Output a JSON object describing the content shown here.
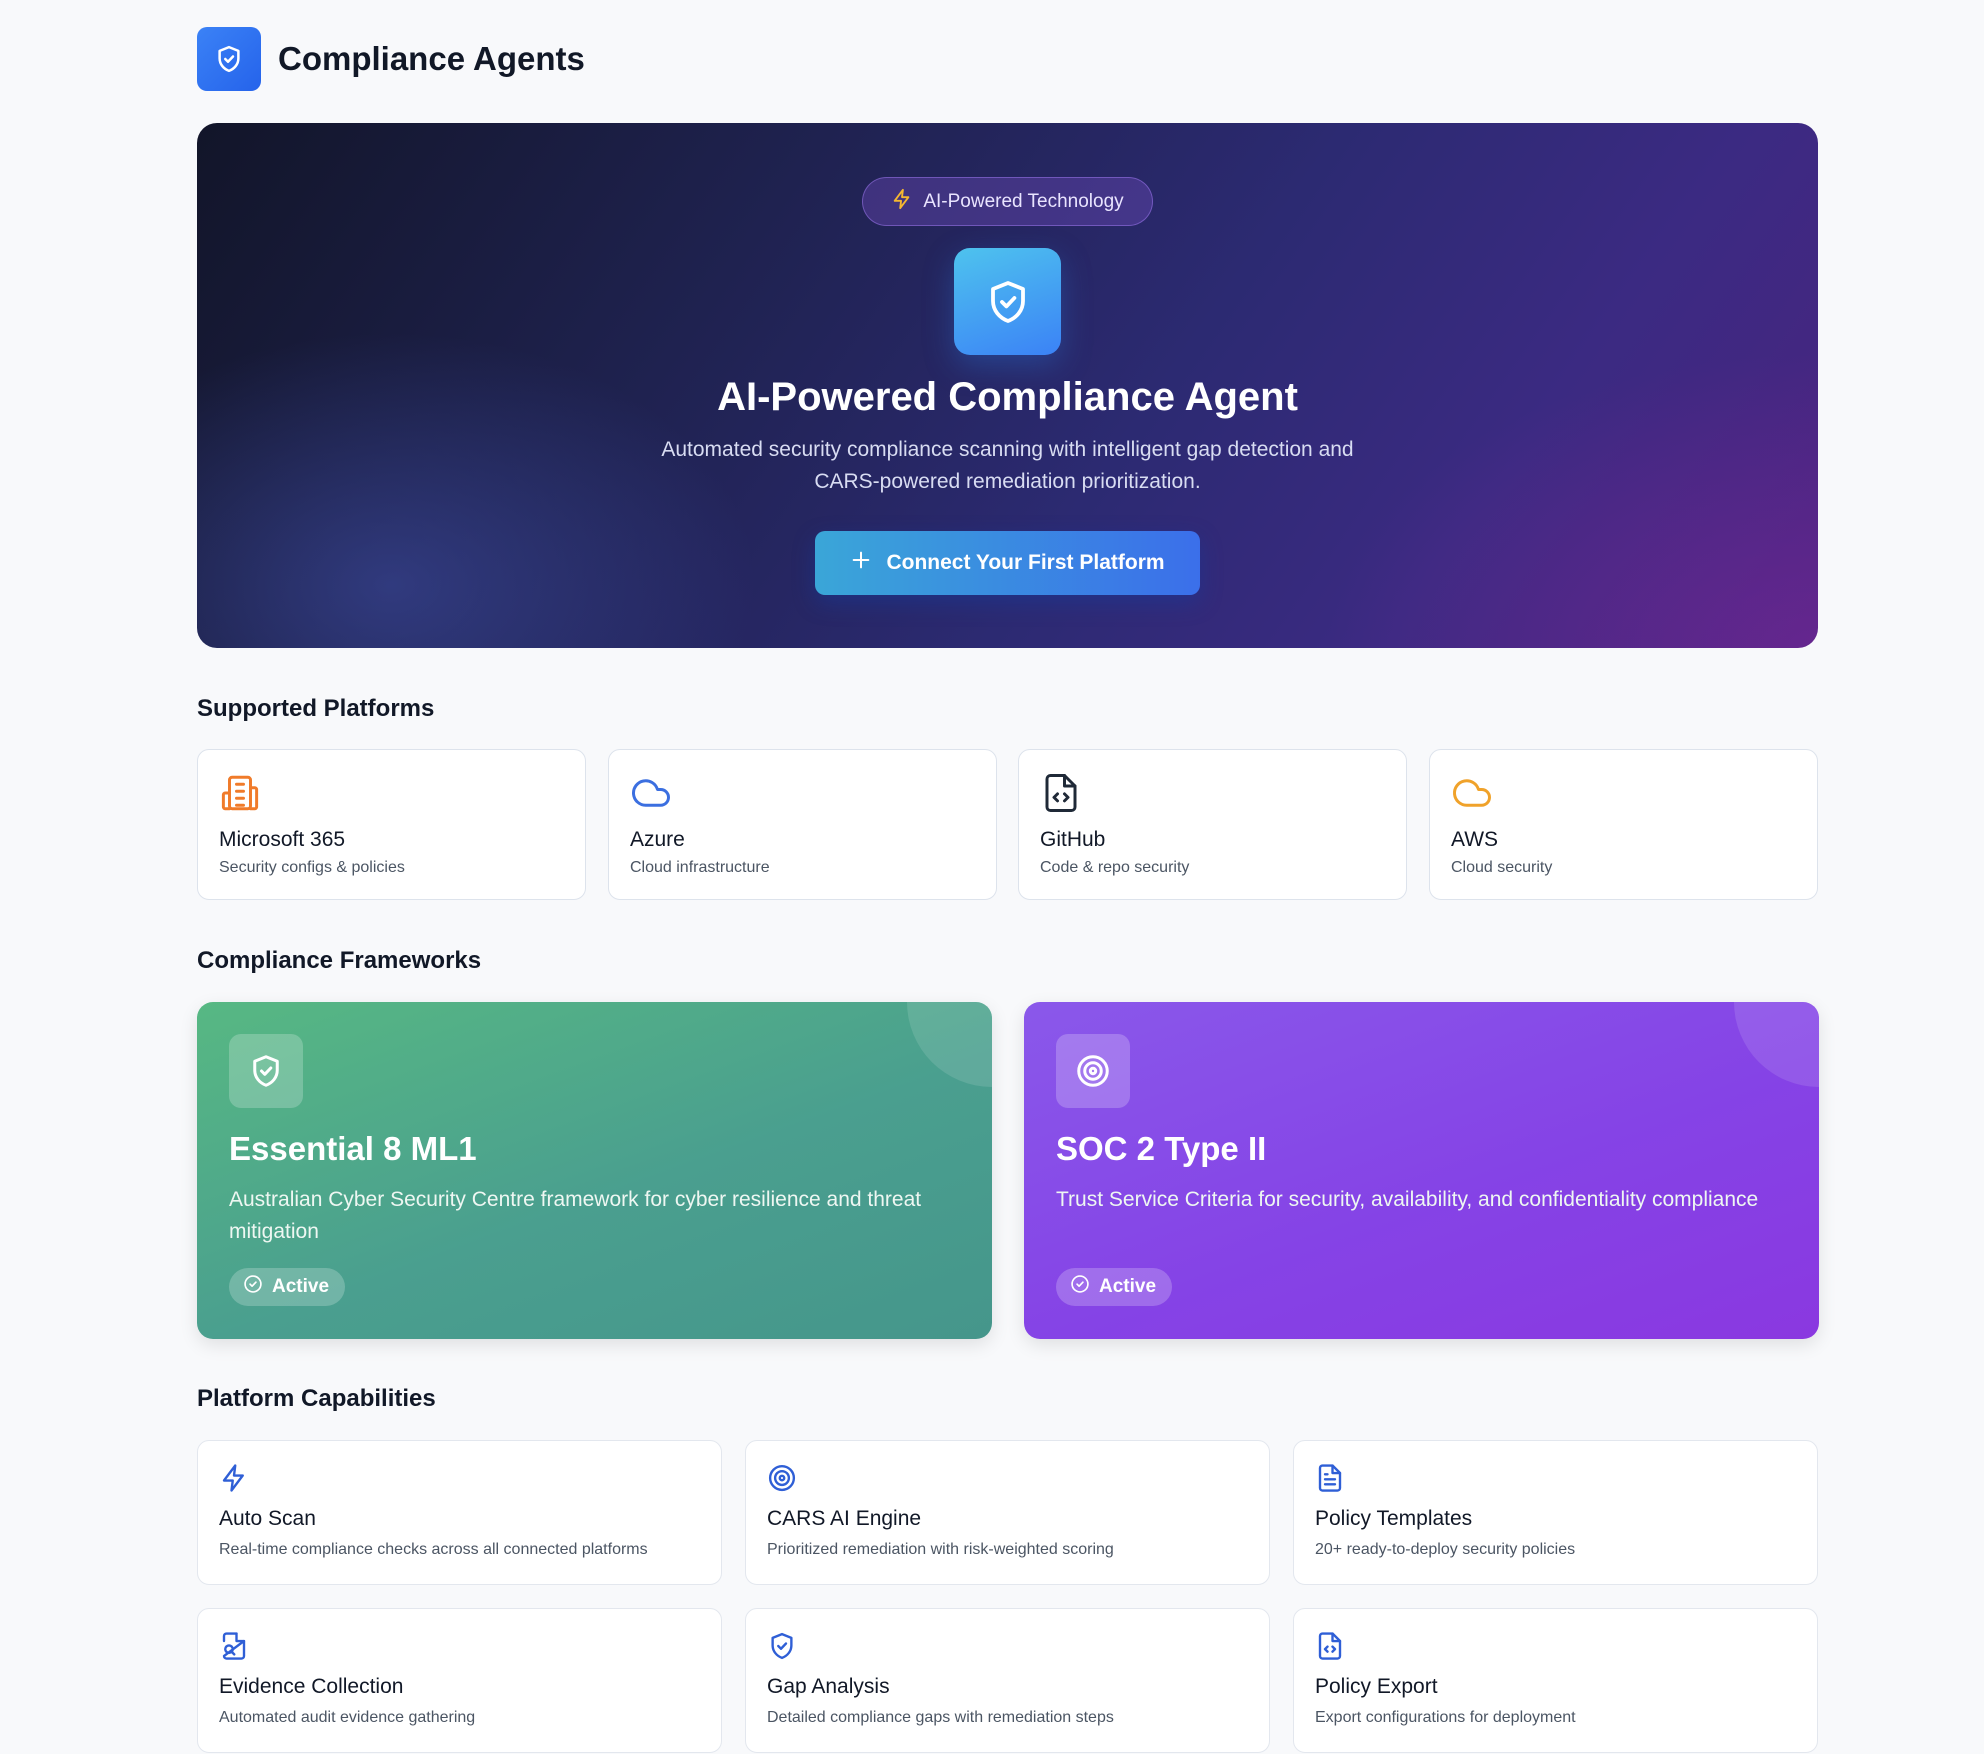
{
  "header": {
    "title": "Compliance Agents",
    "logo_icon": "shield-check-icon"
  },
  "hero": {
    "badge": "AI-Powered Technology",
    "badge_icon": "lightning-icon",
    "icon": "shield-check-icon",
    "title": "AI-Powered Compliance Agent",
    "subtitle_line1": "Automated security compliance scanning with intelligent gap detection and",
    "subtitle_line2": "CARS-powered remediation prioritization.",
    "cta_label": "Connect Your First Platform",
    "cta_icon": "plus-icon"
  },
  "platforms": {
    "title": "Supported Platforms",
    "items": [
      {
        "name": "Microsoft 365",
        "desc": "Security configs & policies",
        "icon": "building-icon",
        "color": "#f07b2a"
      },
      {
        "name": "Azure",
        "desc": "Cloud infrastructure",
        "icon": "cloud-icon",
        "color": "#3b6fe0"
      },
      {
        "name": "GitHub",
        "desc": "Code & repo security",
        "icon": "file-code-icon",
        "color": "#1f2937"
      },
      {
        "name": "AWS",
        "desc": "Cloud security",
        "icon": "cloud-icon",
        "color": "#f0a22a"
      }
    ]
  },
  "frameworks": {
    "title": "Compliance Frameworks",
    "items": [
      {
        "name": "Essential 8 ML1",
        "desc": "Australian Cyber Security Centre framework for cyber resilience and threat mitigation",
        "status": "Active",
        "icon": "shield-check-icon",
        "color": "#4fae88"
      },
      {
        "name": "SOC 2 Type II",
        "desc": "Trust Service Criteria for security, availability, and confidentiality compliance",
        "status": "Active",
        "icon": "target-icon",
        "color": "#8747e6"
      }
    ]
  },
  "capabilities": {
    "title": "Platform Capabilities",
    "items": [
      {
        "name": "Auto Scan",
        "desc": "Real-time compliance checks across all connected platforms",
        "icon": "lightning-icon"
      },
      {
        "name": "CARS AI Engine",
        "desc": "Prioritized remediation with risk-weighted scoring",
        "icon": "target-icon"
      },
      {
        "name": "Policy Templates",
        "desc": "20+ ready-to-deploy security policies",
        "icon": "document-icon"
      },
      {
        "name": "Evidence Collection",
        "desc": "Automated audit evidence gathering",
        "icon": "file-search-icon"
      },
      {
        "name": "Gap Analysis",
        "desc": "Detailed compliance gaps with remediation steps",
        "icon": "shield-check-icon"
      },
      {
        "name": "Policy Export",
        "desc": "Export configurations for deployment",
        "icon": "file-code-icon"
      }
    ],
    "icon_color": "#2f5fd6"
  }
}
